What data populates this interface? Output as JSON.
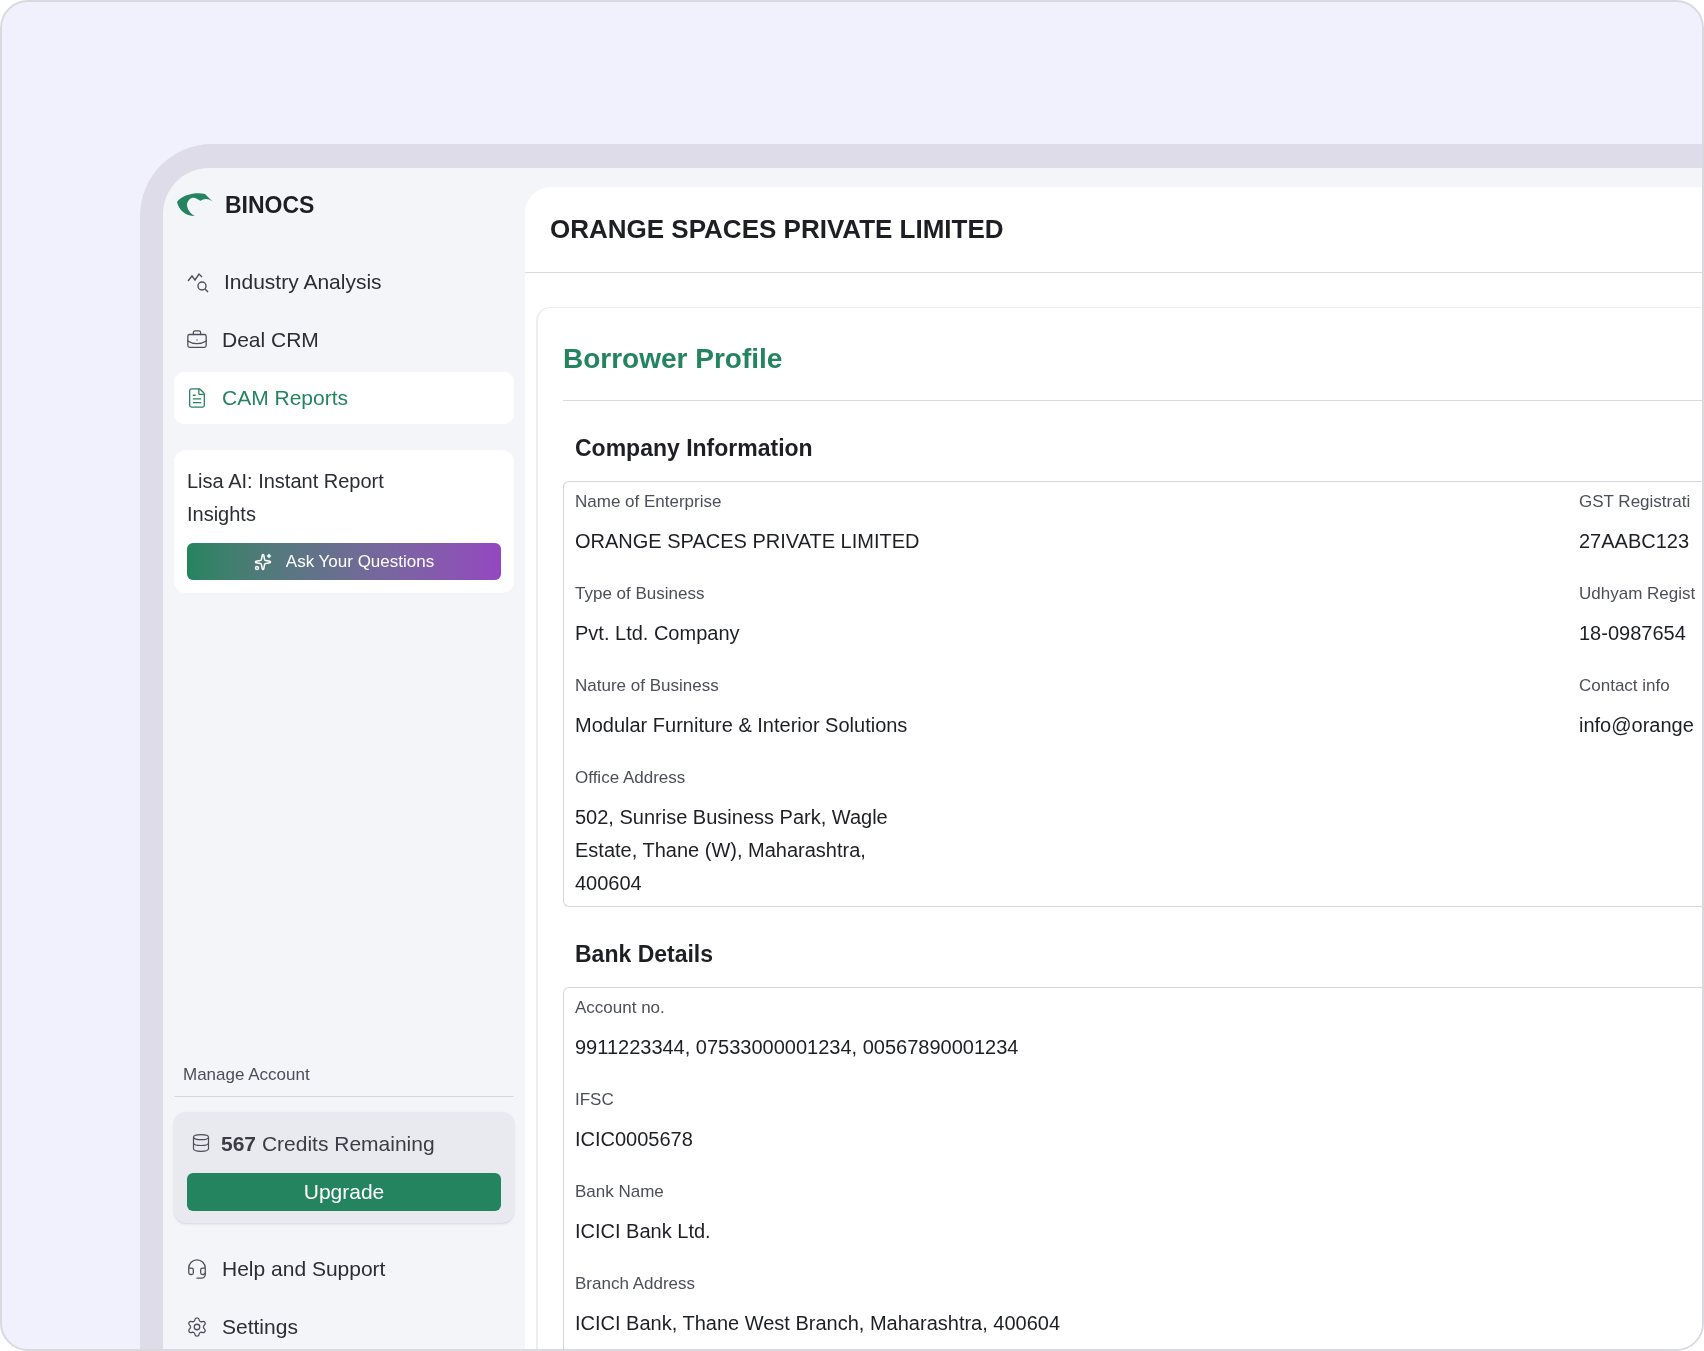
{
  "brand": {
    "name": "BINOCS"
  },
  "nav": [
    {
      "label": "Industry Analysis",
      "selected": false
    },
    {
      "label": "Deal CRM",
      "selected": false
    },
    {
      "label": "CAM Reports",
      "selected": true
    }
  ],
  "assistant_card": {
    "title": "Lisa AI: Instant Report Insights",
    "button": "Ask Your Questions"
  },
  "account": {
    "heading": "Manage Account",
    "credits": "**567** Credits Remaining",
    "upgrade_button": "Upgrade"
  },
  "footer_nav": [
    {
      "label": "Help and Support"
    },
    {
      "label": "Settings"
    }
  ],
  "page_title": "ORANGE SPACES PRIVATE LIMITED",
  "section_title": "Borrower Profile",
  "groups": [
    {
      "title": "Company Information",
      "left": [
        {
          "label": "Name of Enterprise",
          "value": "ORANGE SPACES PRIVATE LIMITED"
        },
        {
          "label": "Type of Business",
          "value": "Pvt. Ltd. Company"
        },
        {
          "label": "Nature of Business",
          "value": "Modular Furniture & Interior Solutions"
        },
        {
          "label": "Office Address",
          "value": "502, Sunrise Business Park, Wagle Estate, Thane (W), Maharashtra, 400604"
        }
      ],
      "right": [
        {
          "label": "GST Registrati",
          "value": "27AABC123"
        },
        {
          "label": "Udhyam Regist",
          "value": "18-0987654"
        },
        {
          "label": "Contact info",
          "value": "info@orange"
        }
      ]
    },
    {
      "title": "Bank Details",
      "left": [
        {
          "label": "Account no.",
          "value": "9911223344, 07533000001234, 00567890001234"
        },
        {
          "label": "IFSC",
          "value": "ICIC0005678"
        },
        {
          "label": "Bank Name",
          "value": "ICICI Bank Ltd."
        },
        {
          "label": "Branch Address",
          "value": "ICICI Bank, Thane West Branch, Maharashtra, 400604"
        }
      ]
    }
  ]
}
